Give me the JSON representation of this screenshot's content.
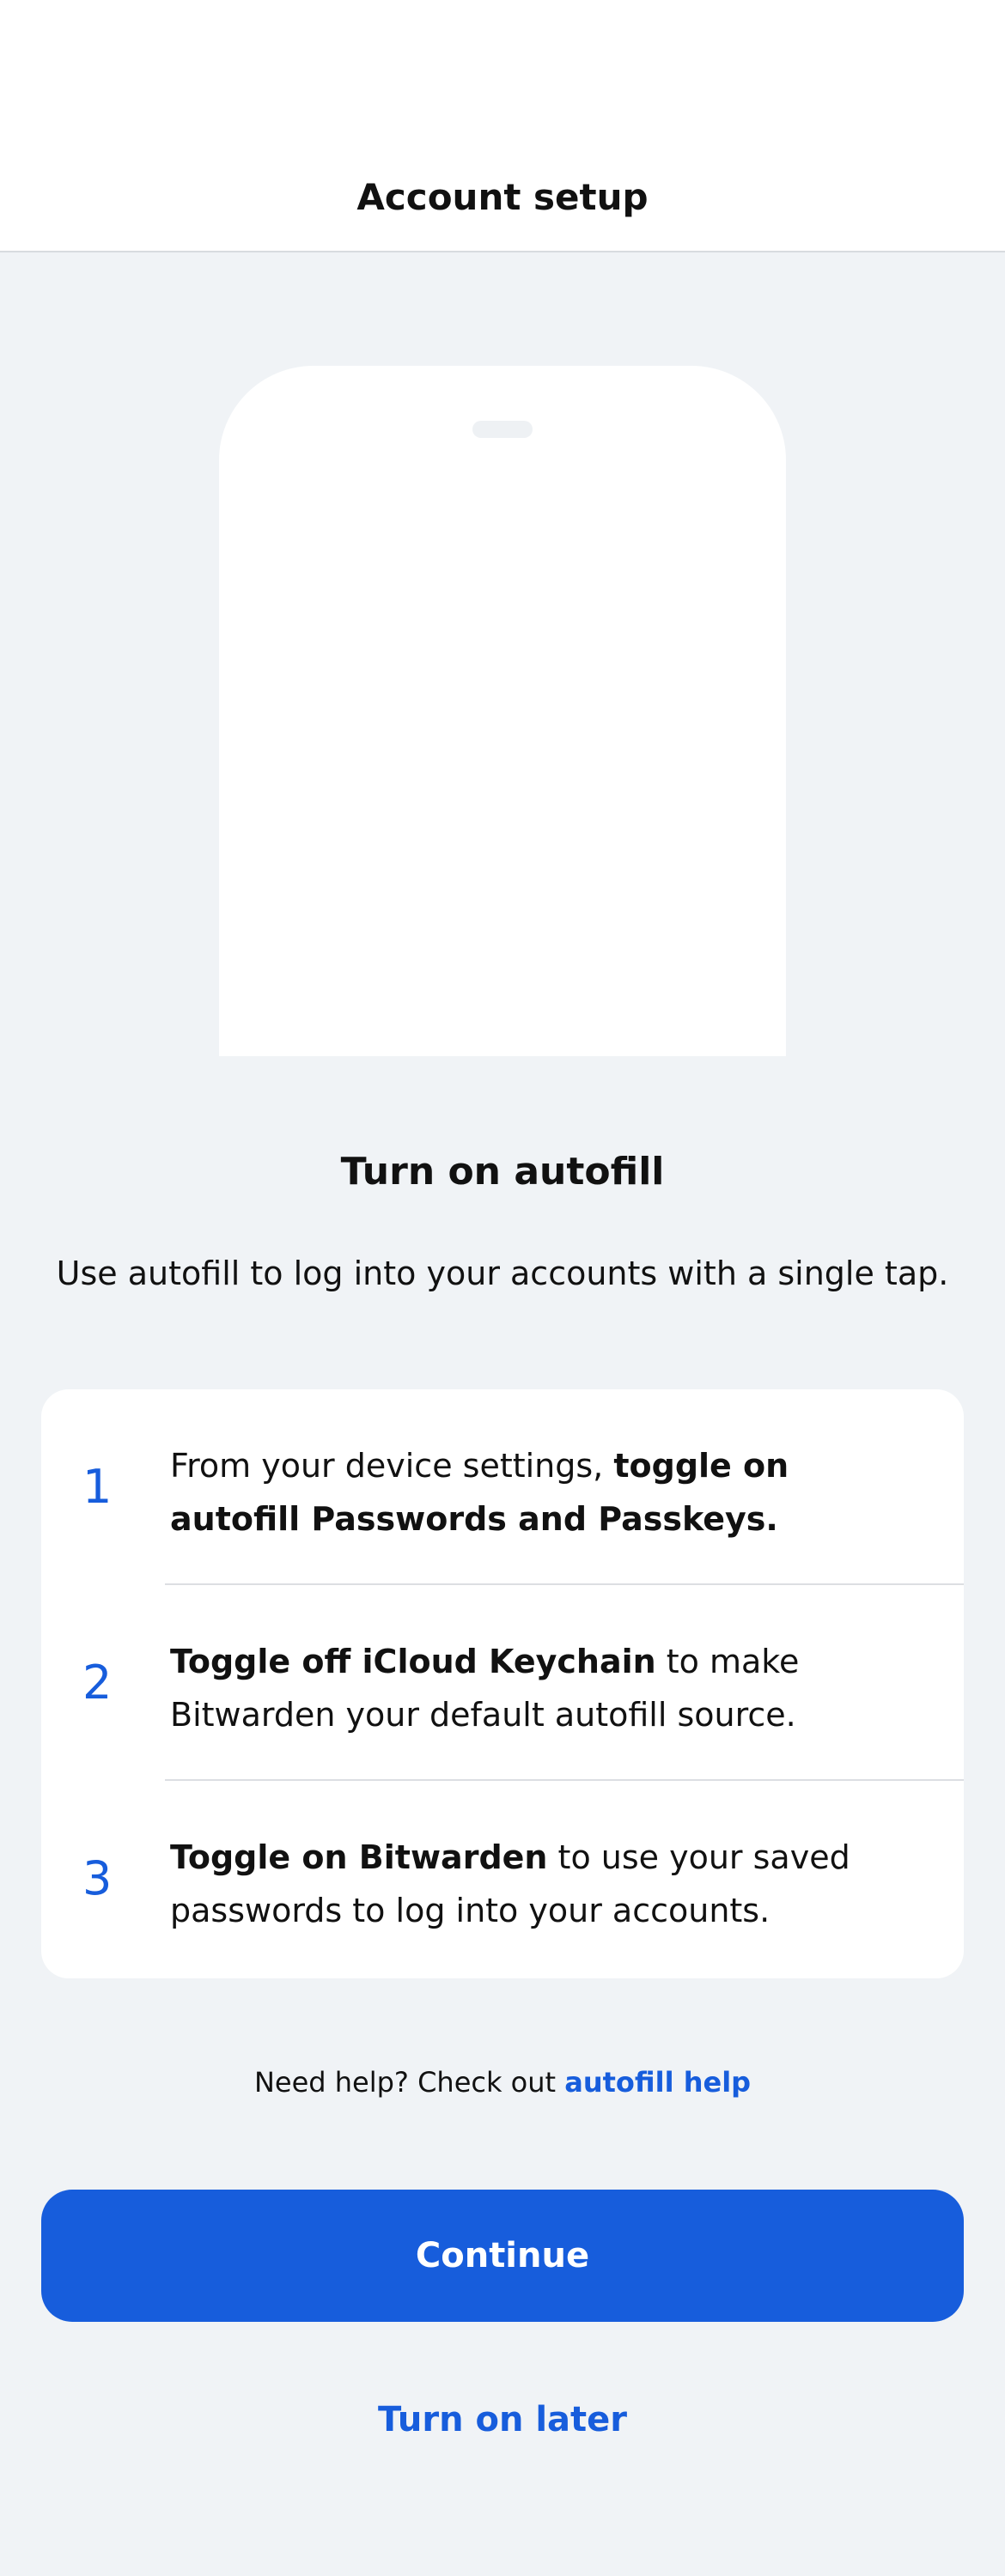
{
  "header": {
    "title": "Account setup"
  },
  "illustration": {
    "name": "phone-autofill-illustration"
  },
  "main": {
    "title": "Turn on autofill",
    "subtitle": "Use autofill to log into your accounts with a single tap."
  },
  "steps": [
    {
      "number": "1",
      "text_plain": "From your device settings, ",
      "text_bold": "toggle on autofill Passwords and Passkeys."
    },
    {
      "number": "2",
      "text_bold": "Toggle off iCloud Keychain",
      "text_plain": " to make Bitwarden your default autofill source."
    },
    {
      "number": "3",
      "text_bold": "Toggle on Bitwarden",
      "text_plain": " to use your saved passwords to log into your accounts."
    }
  ],
  "help": {
    "prefix": "Need help? Check out ",
    "link": "autofill help"
  },
  "actions": {
    "continue_label": "Continue",
    "later_label": "Turn on later"
  },
  "colors": {
    "accent": "#175ddc",
    "background": "#f0f3f6",
    "surface": "#ffffff"
  }
}
